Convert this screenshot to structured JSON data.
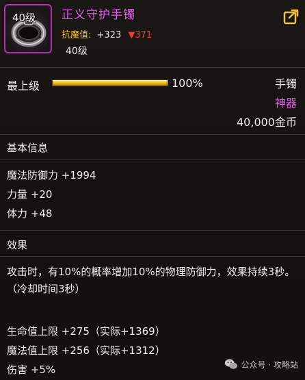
{
  "header": {
    "level_badge": "40级",
    "item_name": "正义守护手镯",
    "resist_label": "抗魔值:",
    "resist_value": "+323",
    "resist_down": "▼371",
    "required_level": "40级"
  },
  "level_bar": {
    "label": "最上级",
    "percent_text": "100%",
    "fill_fraction": 1.0
  },
  "item_meta": {
    "type": "手镯",
    "grade": "神器",
    "price": "40,000金币"
  },
  "basic_info": {
    "title": "基本信息",
    "stats": [
      "魔法防御力 +1994",
      "力量 +20",
      "体力 +48"
    ]
  },
  "effect": {
    "title": "效果",
    "description": "攻击时，有10%的概率增加10%的物理防御力，效果持续3秒。（冷却时间3秒）",
    "stats": [
      "生命值上限 +275（实际+1369）",
      "魔法值上限 +256（实际+1312）",
      "伤害 +5%"
    ]
  },
  "watermark": {
    "text": "公众号 · 攻略站"
  },
  "colors": {
    "epic": "#e060e8",
    "gold": "#f0c040",
    "down": "#e8423a"
  }
}
